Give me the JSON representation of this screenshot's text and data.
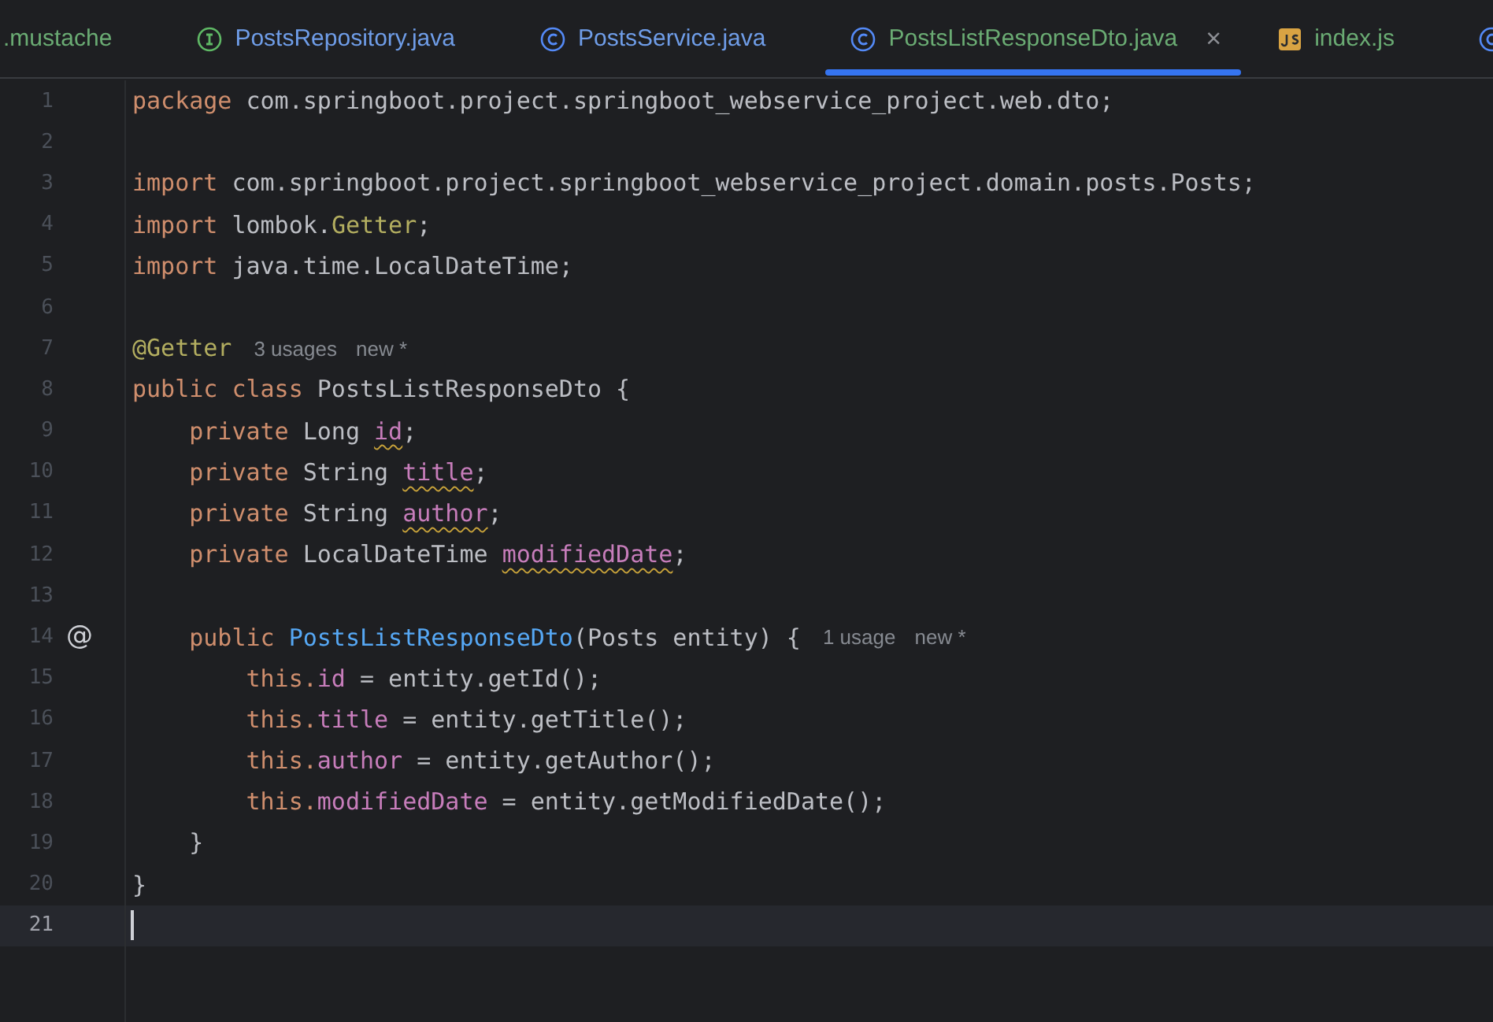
{
  "tabs": [
    {
      "label": ".mustache",
      "kind": "plain",
      "color": "#6aab73",
      "selected": false
    },
    {
      "label": "PostsRepository.java",
      "kind": "interface",
      "color": "#6f9de8",
      "selected": false
    },
    {
      "label": "PostsService.java",
      "kind": "class",
      "color": "#6f9de8",
      "selected": false
    },
    {
      "label": "PostsListResponseDto.java",
      "kind": "class",
      "color": "#6aab73",
      "selected": true,
      "close": "×"
    },
    {
      "label": "index.js",
      "kind": "js",
      "color": "#6aab73",
      "selected": false
    },
    {
      "kind": "class",
      "selected": false
    }
  ],
  "editor": {
    "lines": [
      {
        "number": "1",
        "tokens": [
          {
            "kind": "keyword",
            "text": "package "
          },
          {
            "kind": "text",
            "text": "com.springboot.project.springboot_webservice_project.web.dto;"
          }
        ]
      },
      {
        "number": "2"
      },
      {
        "number": "3",
        "tokens": [
          {
            "kind": "keyword",
            "text": "import "
          },
          {
            "kind": "text",
            "text": "com.springboot.project.springboot_webservice_project.domain.posts.Posts;"
          }
        ]
      },
      {
        "number": "4",
        "tokens": [
          {
            "kind": "keyword",
            "text": "import "
          },
          {
            "kind": "text",
            "text": "lombok."
          },
          {
            "kind": "annotation",
            "text": "Getter"
          },
          {
            "kind": "text",
            "text": ";"
          }
        ]
      },
      {
        "number": "5",
        "tokens": [
          {
            "kind": "keyword",
            "text": "import "
          },
          {
            "kind": "text",
            "text": "java.time.LocalDateTime;"
          }
        ]
      },
      {
        "number": "6"
      },
      {
        "number": "7",
        "tokens": [
          {
            "kind": "annotation",
            "text": "@Getter"
          }
        ],
        "hints": [
          "3 usages",
          "new *"
        ]
      },
      {
        "number": "8",
        "tokens": [
          {
            "kind": "keyword",
            "text": "public class "
          },
          {
            "kind": "text",
            "text": "PostsListResponseDto {"
          }
        ]
      },
      {
        "number": "9",
        "tokens": [
          {
            "kind": "keyword",
            "text": "    private "
          },
          {
            "kind": "text",
            "text": "Long "
          },
          {
            "kind": "field",
            "text": "id",
            "warning": true
          },
          {
            "kind": "text",
            "text": ";"
          }
        ]
      },
      {
        "number": "10",
        "tokens": [
          {
            "kind": "keyword",
            "text": "    private "
          },
          {
            "kind": "text",
            "text": "String "
          },
          {
            "kind": "field",
            "text": "title",
            "warning": true
          },
          {
            "kind": "text",
            "text": ";"
          }
        ]
      },
      {
        "number": "11",
        "tokens": [
          {
            "kind": "keyword",
            "text": "    private "
          },
          {
            "kind": "text",
            "text": "String "
          },
          {
            "kind": "field",
            "text": "author",
            "warning": true
          },
          {
            "kind": "text",
            "text": ";"
          }
        ]
      },
      {
        "number": "12",
        "tokens": [
          {
            "kind": "keyword",
            "text": "    private "
          },
          {
            "kind": "text",
            "text": "LocalDateTime "
          },
          {
            "kind": "field",
            "text": "modifiedDate",
            "warning": true
          },
          {
            "kind": "text",
            "text": ";"
          }
        ]
      },
      {
        "number": "13"
      },
      {
        "number": "14",
        "gutter_mark": "@",
        "tokens": [
          {
            "kind": "keyword",
            "text": "    public "
          },
          {
            "kind": "method",
            "text": "PostsListResponseDto"
          },
          {
            "kind": "text",
            "text": "(Posts entity) {"
          }
        ],
        "hints": [
          "1 usage",
          "new *"
        ]
      },
      {
        "number": "15",
        "tokens": [
          {
            "kind": "keyword",
            "text": "        this."
          },
          {
            "kind": "field",
            "text": "id"
          },
          {
            "kind": "text",
            "text": " = entity.getId();"
          }
        ]
      },
      {
        "number": "16",
        "tokens": [
          {
            "kind": "keyword",
            "text": "        this."
          },
          {
            "kind": "field",
            "text": "title"
          },
          {
            "kind": "text",
            "text": " = entity.getTitle();"
          }
        ]
      },
      {
        "number": "17",
        "tokens": [
          {
            "kind": "keyword",
            "text": "        this."
          },
          {
            "kind": "field",
            "text": "author"
          },
          {
            "kind": "text",
            "text": " = entity.getAuthor();"
          }
        ]
      },
      {
        "number": "18",
        "tokens": [
          {
            "kind": "keyword",
            "text": "        this."
          },
          {
            "kind": "field",
            "text": "modifiedDate"
          },
          {
            "kind": "text",
            "text": " = entity.getModifiedDate();"
          }
        ]
      },
      {
        "number": "19",
        "tokens": [
          {
            "kind": "text",
            "text": "    }"
          }
        ]
      },
      {
        "number": "20",
        "tokens": [
          {
            "kind": "text",
            "text": "}"
          }
        ]
      },
      {
        "number": "21",
        "current": true
      }
    ]
  }
}
